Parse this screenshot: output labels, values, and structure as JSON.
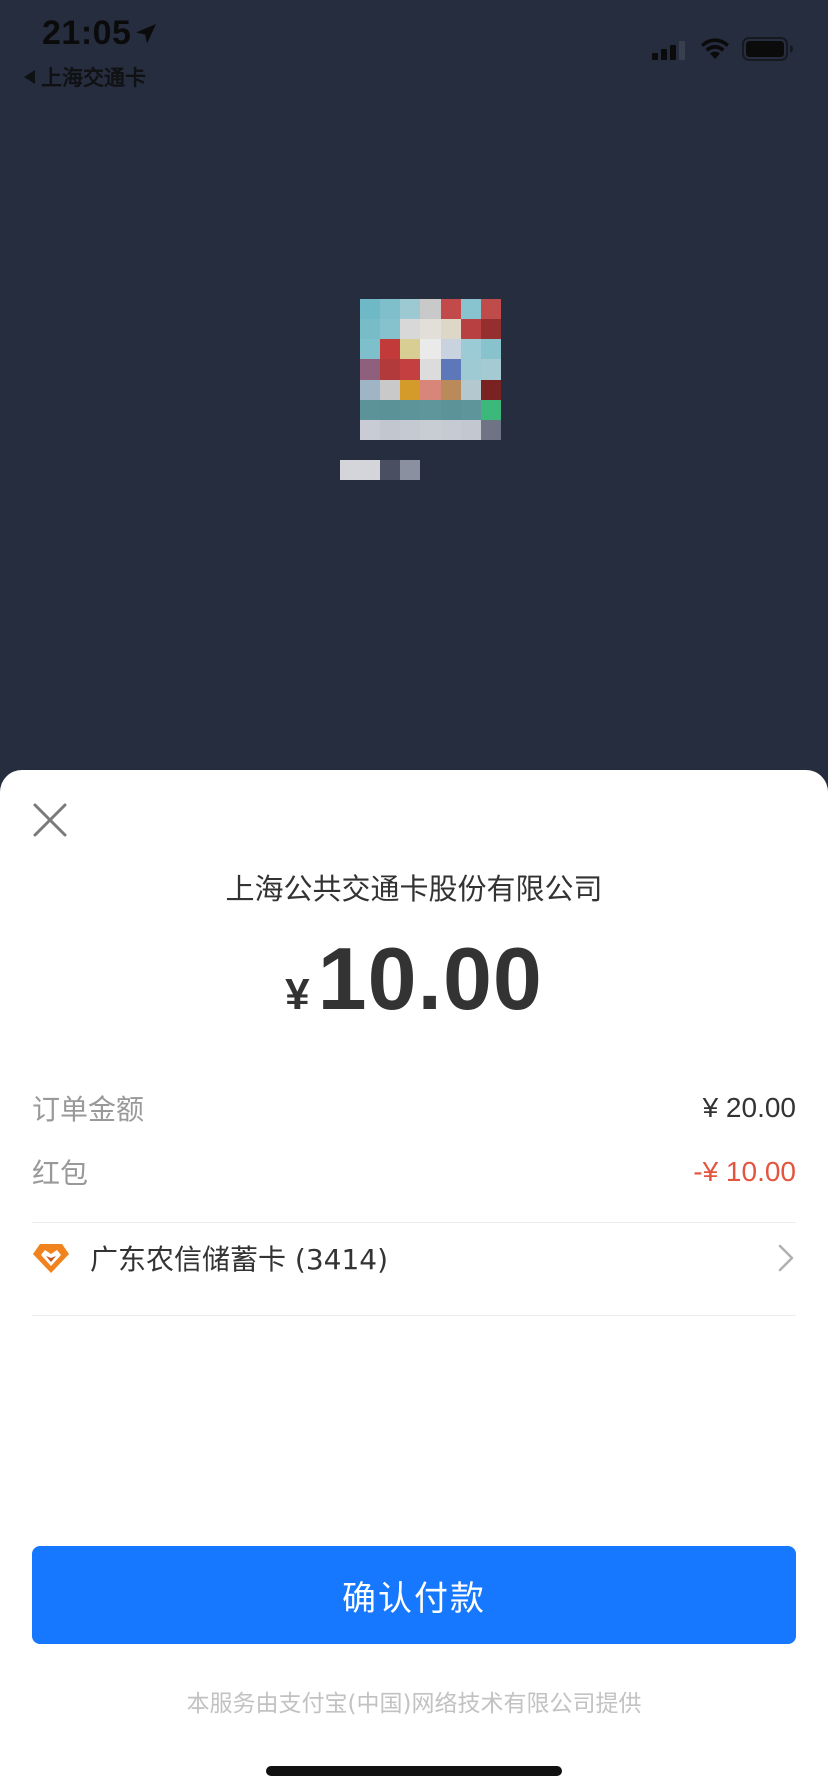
{
  "status_bar": {
    "time": "21:05",
    "back_app_label": "上海交通卡",
    "icons": [
      "location-arrow-icon",
      "cellular-signal-icon",
      "wifi-icon",
      "battery-icon"
    ]
  },
  "payment_sheet": {
    "merchant_name": "上海公共交通卡股份有限公司",
    "currency_symbol": "¥",
    "pay_amount": "10.00",
    "details": [
      {
        "label": "订单金额",
        "value": "¥ 20.00"
      },
      {
        "label": "红包",
        "value": "-¥ 10.00"
      }
    ],
    "payment_method": "广东农信储蓄卡 (3414)",
    "confirm_label": "确认付款",
    "footer_note": "本服务由支付宝(中国)网络技术有限公司提供"
  },
  "colors": {
    "background": "#262d3f",
    "primary_button": "#1677ff",
    "discount_text": "#e4553f",
    "bank_logo": "#f0831e"
  }
}
